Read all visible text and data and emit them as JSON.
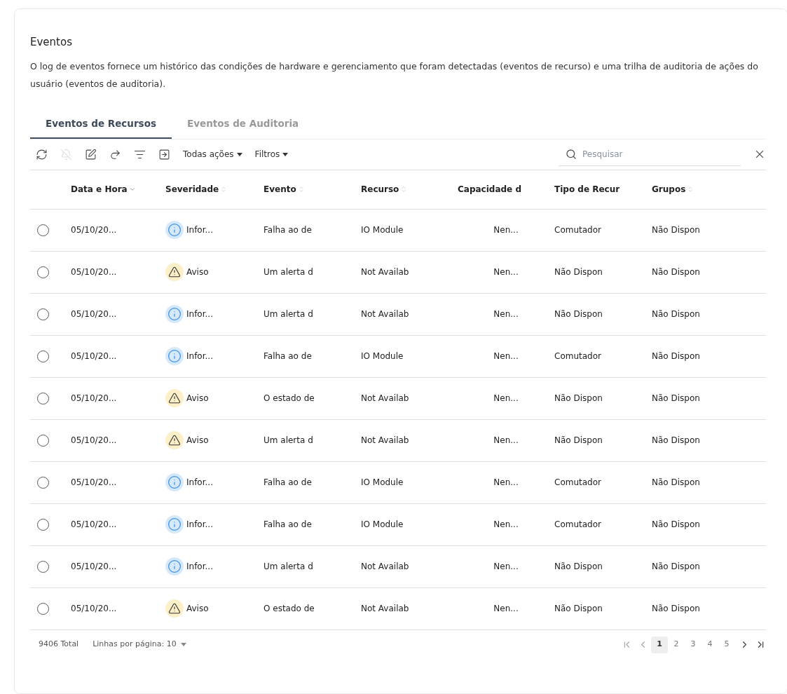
{
  "title": "Eventos",
  "description": "O log de eventos fornece um histórico das condições de hardware e gerenciamento que foram detectadas (eventos de recurso) e uma trilha de auditoria de ações do usuário (eventos de auditoria).",
  "tabs": [
    {
      "label": "Eventos de Recursos",
      "selected": true
    },
    {
      "label": "Eventos de Auditoria",
      "selected": false
    }
  ],
  "toolbar": {
    "tools": [
      {
        "kind": "refresh",
        "disabled": false
      },
      {
        "kind": "ignore",
        "disabled": true
      },
      {
        "kind": "exclude",
        "disabled": false
      },
      {
        "kind": "forward",
        "disabled": false
      },
      {
        "kind": "filter",
        "disabled": false
      },
      {
        "kind": "export",
        "disabled": false
      }
    ],
    "menus": [
      "Todas ações",
      "Filtros"
    ],
    "search": {
      "placeholder": "Pesquisar"
    }
  },
  "table": {
    "columns": [
      {
        "label": "Data e Hora",
        "sorted": true
      },
      {
        "label": "Severidade",
        "sorted": false
      },
      {
        "label": "Evento",
        "sorted": false
      },
      {
        "label": "Recurso",
        "sorted": false
      },
      {
        "label": "Capacidade d"
      },
      {
        "label": "Tipo de Recur"
      },
      {
        "label": "Grupos",
        "sorted": false
      }
    ],
    "rows": [
      {
        "selected": false,
        "date": "05/10/20...",
        "severity": {
          "kind": "info",
          "label": "Infor..."
        },
        "event": "Falha ao de",
        "resource": "IO Module",
        "capacity": "Nen...",
        "type": "Comutador",
        "groups": "Não Dispon"
      },
      {
        "selected": false,
        "date": "05/10/20...",
        "severity": {
          "kind": "warning",
          "label": "Aviso"
        },
        "event": "Um alerta d",
        "resource": "Not Availab",
        "capacity": "Nen...",
        "type": "Não Dispon",
        "groups": "Não Dispon"
      },
      {
        "selected": false,
        "date": "05/10/20...",
        "severity": {
          "kind": "info",
          "label": "Infor..."
        },
        "event": "Um alerta d",
        "resource": "Not Availab",
        "capacity": "Nen...",
        "type": "Não Dispon",
        "groups": "Não Dispon"
      },
      {
        "selected": false,
        "date": "05/10/20...",
        "severity": {
          "kind": "info",
          "label": "Infor..."
        },
        "event": "Falha ao de",
        "resource": "IO Module",
        "capacity": "Nen...",
        "type": "Comutador",
        "groups": "Não Dispon"
      },
      {
        "selected": false,
        "date": "05/10/20...",
        "severity": {
          "kind": "warning",
          "label": "Aviso"
        },
        "event": "O estado de",
        "resource": "Not Availab",
        "capacity": "Nen...",
        "type": "Não Dispon",
        "groups": "Não Dispon"
      },
      {
        "selected": false,
        "date": "05/10/20...",
        "severity": {
          "kind": "warning",
          "label": "Aviso"
        },
        "event": "Um alerta d",
        "resource": "Not Availab",
        "capacity": "Nen...",
        "type": "Não Dispon",
        "groups": "Não Dispon"
      },
      {
        "selected": false,
        "date": "05/10/20...",
        "severity": {
          "kind": "info",
          "label": "Infor..."
        },
        "event": "Falha ao de",
        "resource": "IO Module",
        "capacity": "Nen...",
        "type": "Comutador",
        "groups": "Não Dispon"
      },
      {
        "selected": false,
        "date": "05/10/20...",
        "severity": {
          "kind": "info",
          "label": "Infor..."
        },
        "event": "Falha ao de",
        "resource": "IO Module",
        "capacity": "Nen...",
        "type": "Comutador",
        "groups": "Não Dispon"
      },
      {
        "selected": false,
        "date": "05/10/20...",
        "severity": {
          "kind": "info",
          "label": "Infor..."
        },
        "event": "Um alerta d",
        "resource": "Not Availab",
        "capacity": "Nen...",
        "type": "Não Dispon",
        "groups": "Não Dispon"
      },
      {
        "selected": false,
        "date": "05/10/20...",
        "severity": {
          "kind": "warning",
          "label": "Aviso"
        },
        "event": "O estado de",
        "resource": "Not Availab",
        "capacity": "Nen...",
        "type": "Não Dispon",
        "groups": "Não Dispon"
      }
    ]
  },
  "footer": {
    "total": "9406 Total",
    "rows_per_page": "Linhas por página: 10",
    "pages": [
      {
        "label": "1",
        "selected": true
      },
      {
        "label": "2",
        "selected": false
      },
      {
        "label": "3",
        "selected": false
      },
      {
        "label": "4",
        "selected": false
      },
      {
        "label": "5",
        "selected": false
      }
    ]
  }
}
